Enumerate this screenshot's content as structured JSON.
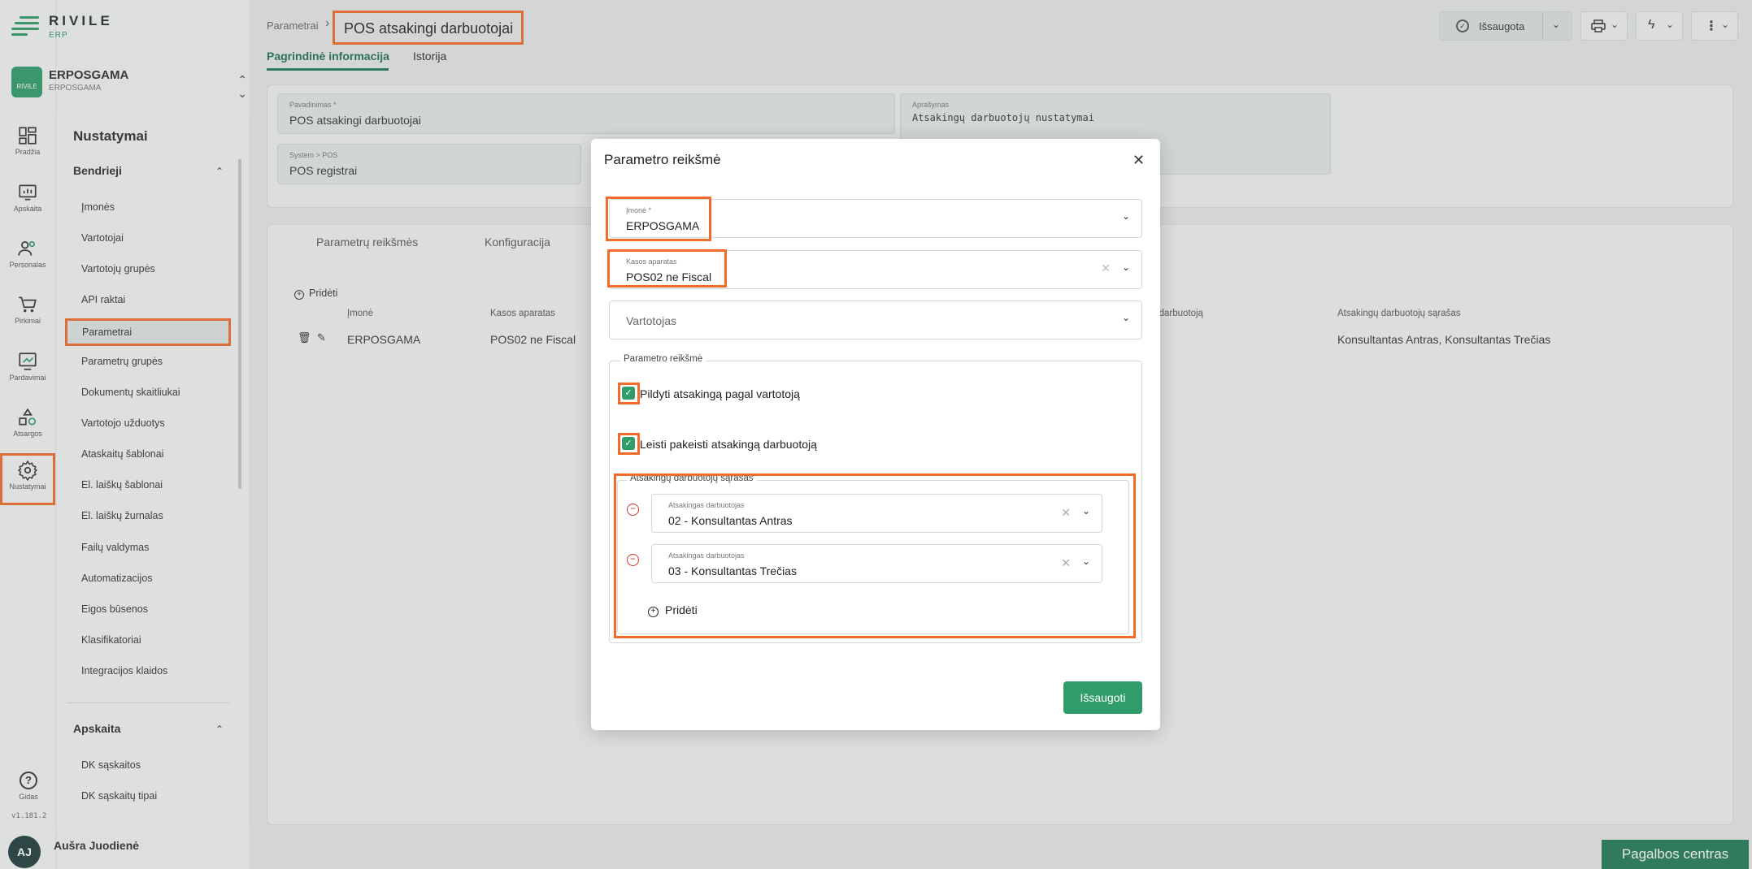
{
  "brand": {
    "name": "RIVILE",
    "sub": "ERP"
  },
  "company": {
    "name": "ERPOSGAMA",
    "sub": "ERPOSGAMA",
    "badge_text": "RIVILE"
  },
  "rail": [
    {
      "label": "Pradžia",
      "icon": "dashboard-icon"
    },
    {
      "label": "Apskaita",
      "icon": "accounting-icon"
    },
    {
      "label": "Personalas",
      "icon": "people-icon"
    },
    {
      "label": "Pirkimai",
      "icon": "cart-icon"
    },
    {
      "label": "Pardavimai",
      "icon": "sales-icon"
    },
    {
      "label": "Atsargos",
      "icon": "inventory-icon"
    },
    {
      "label": "Nustatymai",
      "icon": "gear-icon"
    }
  ],
  "sidemenu": {
    "title": "Nustatymai",
    "group1": "Bendrieji",
    "items": [
      "Įmonės",
      "Vartotojai",
      "Vartotojų grupės",
      "API raktai",
      "Parametrai",
      "Parametrų grupės",
      "Dokumentų skaitliukai",
      "Vartotojo užduotys",
      "Ataskaitų šablonai",
      "El. laiškų šablonai",
      "El. laiškų žurnalas",
      "Failų valdymas",
      "Automatizacijos",
      "Eigos būsenos",
      "Klasifikatoriai",
      "Integracijos klaidos"
    ],
    "group2": "Apskaita",
    "items2": [
      "DK sąskaitos",
      "DK sąskaitų tipai"
    ]
  },
  "help": {
    "label": "Gidas",
    "version": "v1.181.2"
  },
  "user": {
    "initials": "AJ",
    "name": "Aušra Juodienė"
  },
  "header": {
    "breadcrumb": "Parametrai",
    "title": "POS atsakingi darbuotojai",
    "tabs": [
      "Pagrindinė informacija",
      "Istorija"
    ],
    "save_status": "Išsaugota"
  },
  "form": {
    "name_label": "Pavadinimas *",
    "name_value": "POS atsakingi darbuotojai",
    "desc_label": "Aprašymas",
    "desc_value": "Atsakingų darbuotojų nustatymai",
    "system_label": "System > POS",
    "system_value": "POS registrai"
  },
  "inner_tabs": [
    "Parametrų reikšmės",
    "Konfiguracija"
  ],
  "table": {
    "add_label": "Pridėti",
    "headers": [
      "Įmonė",
      "Kasos aparatas",
      "...darbuotoją",
      "Atsakingų darbuotojų sąrašas"
    ],
    "row": [
      "ERPOSGAMA",
      "POS02 ne Fiscal",
      "Konsultantas Antras, Konsultantas Trečias"
    ]
  },
  "modal": {
    "title": "Parametro reikšmė",
    "company_label": "Įmonė *",
    "company_value": "ERPOSGAMA",
    "register_label": "Kasos aparatas",
    "register_value": "POS02 ne Fiscal",
    "user_placeholder": "Vartotojas",
    "fieldset_legend": "Parametro reikšmė",
    "cb1_label": "Pildyti atsakingą pagal vartotoją",
    "cb2_label": "Leisti pakeisti atsakingą darbuotoją",
    "list_legend": "Atsakingų darbuotojų sąrašas",
    "employee_label": "Atsakingas darbuotojas",
    "employees": [
      "02 - Konsultantas Antras",
      "03 - Konsultantas Trečias"
    ],
    "add_label": "Pridėti",
    "save_label": "Išsaugoti"
  },
  "helpcenter": "Pagalbos centras",
  "colors": {
    "accent": "#2f9c6a",
    "highlight": "#f26b2a",
    "dark_green": "#1f7a54"
  }
}
